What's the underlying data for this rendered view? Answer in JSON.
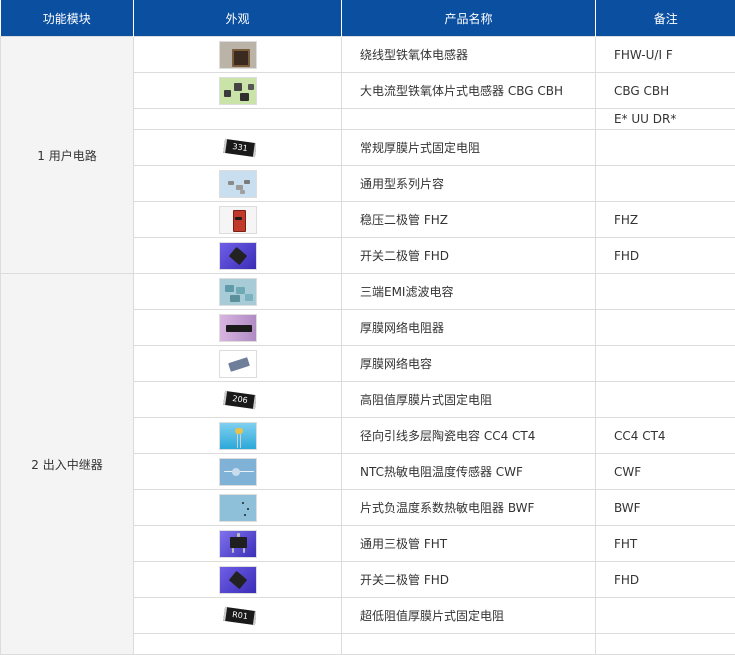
{
  "header": {
    "col_module": "功能模块",
    "col_appearance": "外观",
    "col_name": "产品名称",
    "col_note": "备注"
  },
  "groups": [
    {
      "module": "1 用户电路",
      "rows": [
        {
          "icon": "inductor-image",
          "name": "绕线型铁氧体电感器",
          "note": "FHW-U/I F"
        },
        {
          "icon": "chip-inductor-image",
          "name": "大电流型铁氧体片式电感器 CBG CBH",
          "note": "CBG CBH"
        },
        {
          "icon": "",
          "name": "",
          "note": "E* UU DR*"
        },
        {
          "icon": "chip-resistor-image",
          "label": "331",
          "name": "常规厚膜片式固定电阻",
          "note": ""
        },
        {
          "icon": "mlcc-image",
          "name": "通用型系列片容",
          "note": ""
        },
        {
          "icon": "zener-diode-image",
          "name": "稳压二极管 FHZ",
          "note": "FHZ"
        },
        {
          "icon": "switch-diode-image",
          "name": "开关二极管 FHD",
          "note": "FHD"
        }
      ]
    },
    {
      "module": "2 出入中继器",
      "rows": [
        {
          "icon": "emi-filter-image",
          "name": "三端EMI滤波电容",
          "note": ""
        },
        {
          "icon": "resistor-network-image",
          "name": "厚膜网络电阻器",
          "note": ""
        },
        {
          "icon": "capacitor-network-image",
          "name": "厚膜网络电容",
          "note": ""
        },
        {
          "icon": "chip-resistor-image",
          "label": "206",
          "name": "高阻值厚膜片式固定电阻",
          "note": ""
        },
        {
          "icon": "ceramic-capacitor-image",
          "name": "径向引线多层陶瓷电容 CC4 CT4",
          "note": "CC4 CT4"
        },
        {
          "icon": "ntc-sensor-image",
          "name": "NTC热敏电阻温度传感器 CWF",
          "note": "CWF"
        },
        {
          "icon": "chip-thermistor-image",
          "name": "片式负温度系数热敏电阻器 BWF",
          "note": "BWF"
        },
        {
          "icon": "transistor-image",
          "name": "通用三极管 FHT",
          "note": "FHT"
        },
        {
          "icon": "switch-diode-image",
          "name": "开关二极管 FHD",
          "note": "FHD"
        },
        {
          "icon": "chip-resistor-image",
          "label": "R01",
          "name": "超低阻值厚膜片式固定电阻",
          "note": ""
        }
      ]
    }
  ]
}
